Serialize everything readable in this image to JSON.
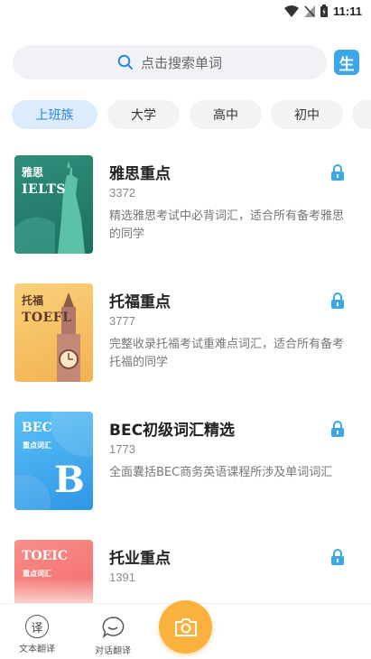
{
  "status_bar": {
    "time": "11:11"
  },
  "search": {
    "placeholder": "点击搜索单词",
    "dict_label": "生"
  },
  "tabs": [
    {
      "label": "上班族",
      "active": true
    },
    {
      "label": "大学",
      "active": false
    },
    {
      "label": "高中",
      "active": false
    },
    {
      "label": "初中",
      "active": false
    }
  ],
  "books": [
    {
      "cover_title": "雅思",
      "cover_sub": "IELTS",
      "title": "雅思重点",
      "count": "3372",
      "desc": "精选雅思考试中必背词汇，适合所有备考雅思的同学"
    },
    {
      "cover_title": "托福",
      "cover_sub": "TOEFL",
      "title": "托福重点",
      "count": "3777",
      "desc": "完整收录托福考试重难点词汇，适合所有备考托福的同学"
    },
    {
      "cover_title": "BEC",
      "cover_sub": "重点词汇",
      "cover_letter": "B",
      "title": "BEC初级词汇精选",
      "count": "1773",
      "desc": "全面囊括BEC商务英语课程所涉及单词词汇"
    },
    {
      "cover_title": "TOEIC",
      "cover_sub": "重点词汇",
      "title": "托业重点",
      "count": "1391",
      "desc": ""
    }
  ],
  "bottom_nav": {
    "text_translate": {
      "icon_char": "译",
      "label": "文本翻译"
    },
    "dialog_translate": {
      "label": "对话翻译"
    }
  },
  "colors": {
    "accent": "#2b86e2",
    "camera": "#fbb13d",
    "lock": "#3ba7e8"
  }
}
